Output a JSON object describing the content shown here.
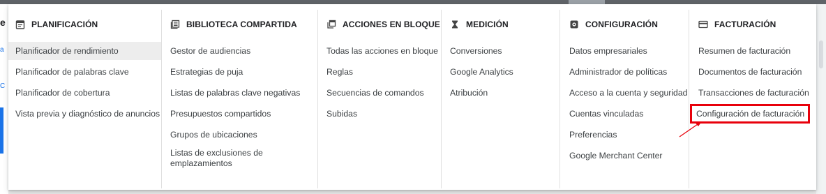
{
  "columns": [
    {
      "title": "PLANIFICACIÓN",
      "icon": "calendar-icon",
      "items": [
        "Planificador de rendimiento",
        "Planificador de palabras clave",
        "Planificador de cobertura",
        "Vista previa y diagnóstico de anuncios"
      ]
    },
    {
      "title": "BIBLIOTECA COMPARTIDA",
      "icon": "library-icon",
      "items": [
        "Gestor de audiencias",
        "Estrategias de puja",
        "Listas de palabras clave negativas",
        "Presupuestos compartidos",
        "Grupos de ubicaciones",
        "Listas de exclusiones de emplazamientos"
      ]
    },
    {
      "title": "ACCIONES EN BLOQUE",
      "icon": "copy-icon",
      "items": [
        "Todas las acciones en bloque",
        "Reglas",
        "Secuencias de comandos",
        "Subidas"
      ]
    },
    {
      "title": "MEDICIÓN",
      "icon": "hourglass-icon",
      "items": [
        "Conversiones",
        "Google Analytics",
        "Atribución"
      ]
    },
    {
      "title": "CONFIGURACIÓN",
      "icon": "settings-icon",
      "items": [
        "Datos empresariales",
        "Administrador de políticas",
        "Acceso a la cuenta y seguridad",
        "Cuentas vinculadas",
        "Preferencias",
        "Google Merchant Center"
      ]
    },
    {
      "title": "FACTURACIÓN",
      "icon": "credit-card-icon",
      "items": [
        "Resumen de facturación",
        "Documentos de facturación",
        "Transacciones de facturación",
        "Configuración de facturación"
      ]
    }
  ],
  "background": {
    "left_letter_e": "e",
    "left_letter_a": "a",
    "left_letter_c": "C"
  },
  "colors": {
    "highlight": "#e8000b",
    "active_item_bg": "#ededed",
    "text": "#3c4043",
    "heading": "#202124"
  }
}
